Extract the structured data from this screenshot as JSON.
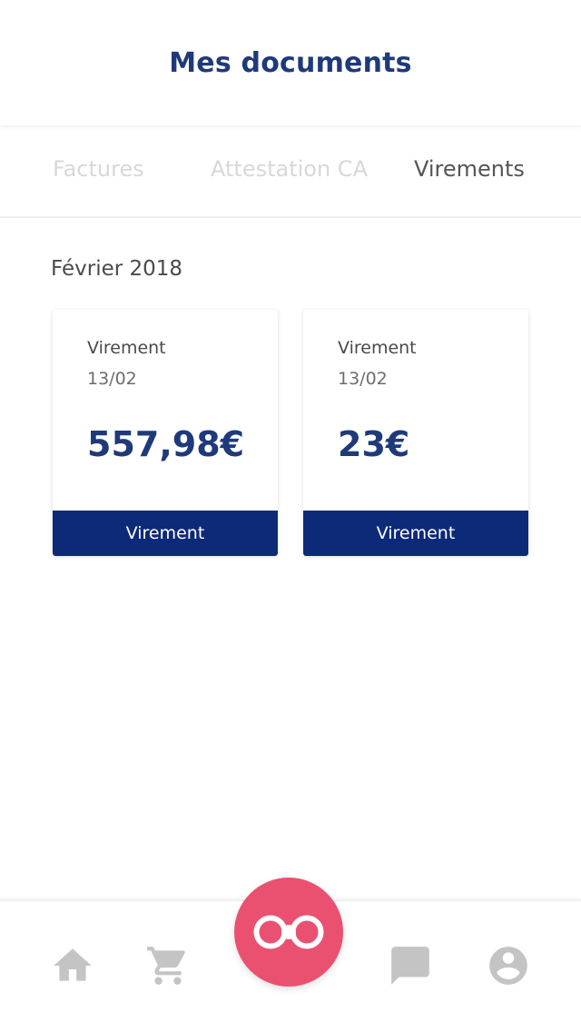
{
  "header": {
    "title": "Mes documents"
  },
  "tabs": [
    {
      "label": "Factures",
      "active": false
    },
    {
      "label": "Attestation CA",
      "active": false
    },
    {
      "label": "Virements",
      "active": true
    }
  ],
  "section": {
    "title": "Février 2018"
  },
  "cards": [
    {
      "type": "Virement",
      "date": "13/02",
      "amount": "557,98€",
      "button_label": "Virement"
    },
    {
      "type": "Virement",
      "date": "13/02",
      "amount": "23€",
      "button_label": "Virement"
    }
  ],
  "bottom_nav": {
    "items": [
      {
        "icon": "home-icon"
      },
      {
        "icon": "cart-icon"
      },
      {
        "icon": "chat-icon"
      },
      {
        "icon": "profile-icon"
      }
    ],
    "fab_icon": "brand-logo-icon"
  },
  "colors": {
    "primary": "#1f3a7a",
    "button": "#0c2a78",
    "accent": "#ea5170",
    "icon_gray": "#c4c4c4"
  }
}
